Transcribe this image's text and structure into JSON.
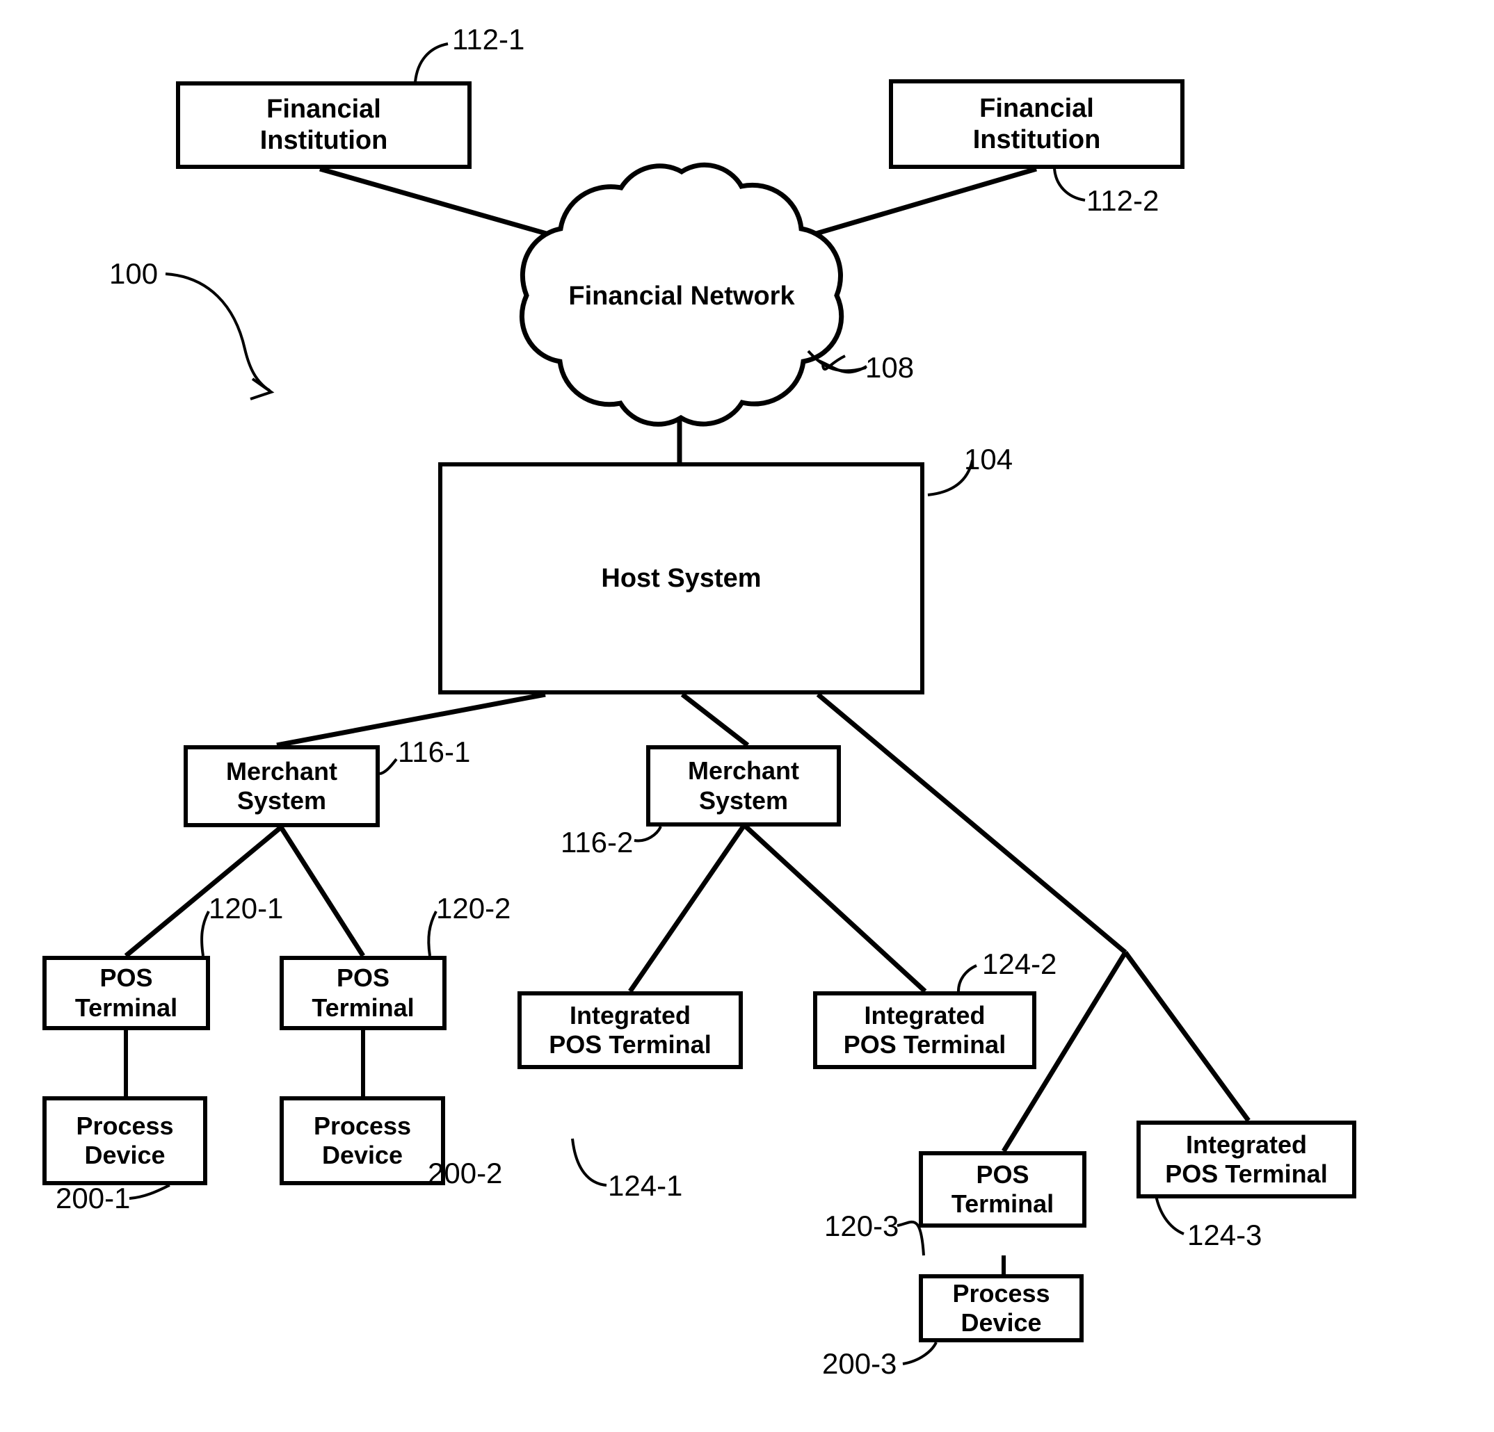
{
  "figure": {
    "type": "patent-block-diagram",
    "background_color": "#ffffff",
    "stroke_color": "#000000",
    "system_reference": "100"
  },
  "nodes": {
    "financial_institution_1": {
      "line1": "Financial",
      "line2": "Institution",
      "ref": "112-1"
    },
    "financial_institution_2": {
      "line1": "Financial",
      "line2": "Institution",
      "ref": "112-2"
    },
    "financial_network": {
      "label": "Financial Network",
      "ref": "108"
    },
    "host_system": {
      "label": "Host System",
      "ref": "104"
    },
    "merchant_system_1": {
      "line1": "Merchant",
      "line2": "System",
      "ref": "116-1"
    },
    "merchant_system_2": {
      "line1": "Merchant",
      "line2": "System",
      "ref": "116-2"
    },
    "pos_terminal_1": {
      "line1": "POS",
      "line2": "Terminal",
      "ref": "120-1"
    },
    "pos_terminal_2": {
      "line1": "POS",
      "line2": "Terminal",
      "ref": "120-2"
    },
    "pos_terminal_3": {
      "line1": "POS",
      "line2": "Terminal",
      "ref": "120-3"
    },
    "process_device_1": {
      "line1": "Process",
      "line2": "Device",
      "ref": "200-1"
    },
    "process_device_2": {
      "line1": "Process",
      "line2": "Device",
      "ref": "200-2"
    },
    "process_device_3": {
      "line1": "Process",
      "line2": "Device",
      "ref": "200-3"
    },
    "integrated_pos_terminal_1": {
      "line1": "Integrated",
      "line2": "POS Terminal",
      "ref": "124-1"
    },
    "integrated_pos_terminal_2": {
      "line1": "Integrated",
      "line2": "POS Terminal",
      "ref": "124-2"
    },
    "integrated_pos_terminal_3": {
      "line1": "Integrated",
      "line2": "POS Terminal",
      "ref": "124-3"
    }
  },
  "connections": [
    {
      "from": "financial_institution_1",
      "to": "financial_network"
    },
    {
      "from": "financial_institution_2",
      "to": "financial_network"
    },
    {
      "from": "financial_network",
      "to": "host_system"
    },
    {
      "from": "host_system",
      "to": "merchant_system_1"
    },
    {
      "from": "host_system",
      "to": "merchant_system_2"
    },
    {
      "from": "host_system",
      "to": "pos_terminal_3"
    },
    {
      "from": "host_system",
      "to": "integrated_pos_terminal_3"
    },
    {
      "from": "merchant_system_1",
      "to": "pos_terminal_1"
    },
    {
      "from": "merchant_system_1",
      "to": "pos_terminal_2"
    },
    {
      "from": "merchant_system_2",
      "to": "integrated_pos_terminal_1"
    },
    {
      "from": "merchant_system_2",
      "to": "integrated_pos_terminal_2"
    },
    {
      "from": "pos_terminal_1",
      "to": "process_device_1"
    },
    {
      "from": "pos_terminal_2",
      "to": "process_device_2"
    },
    {
      "from": "pos_terminal_3",
      "to": "process_device_3"
    }
  ]
}
